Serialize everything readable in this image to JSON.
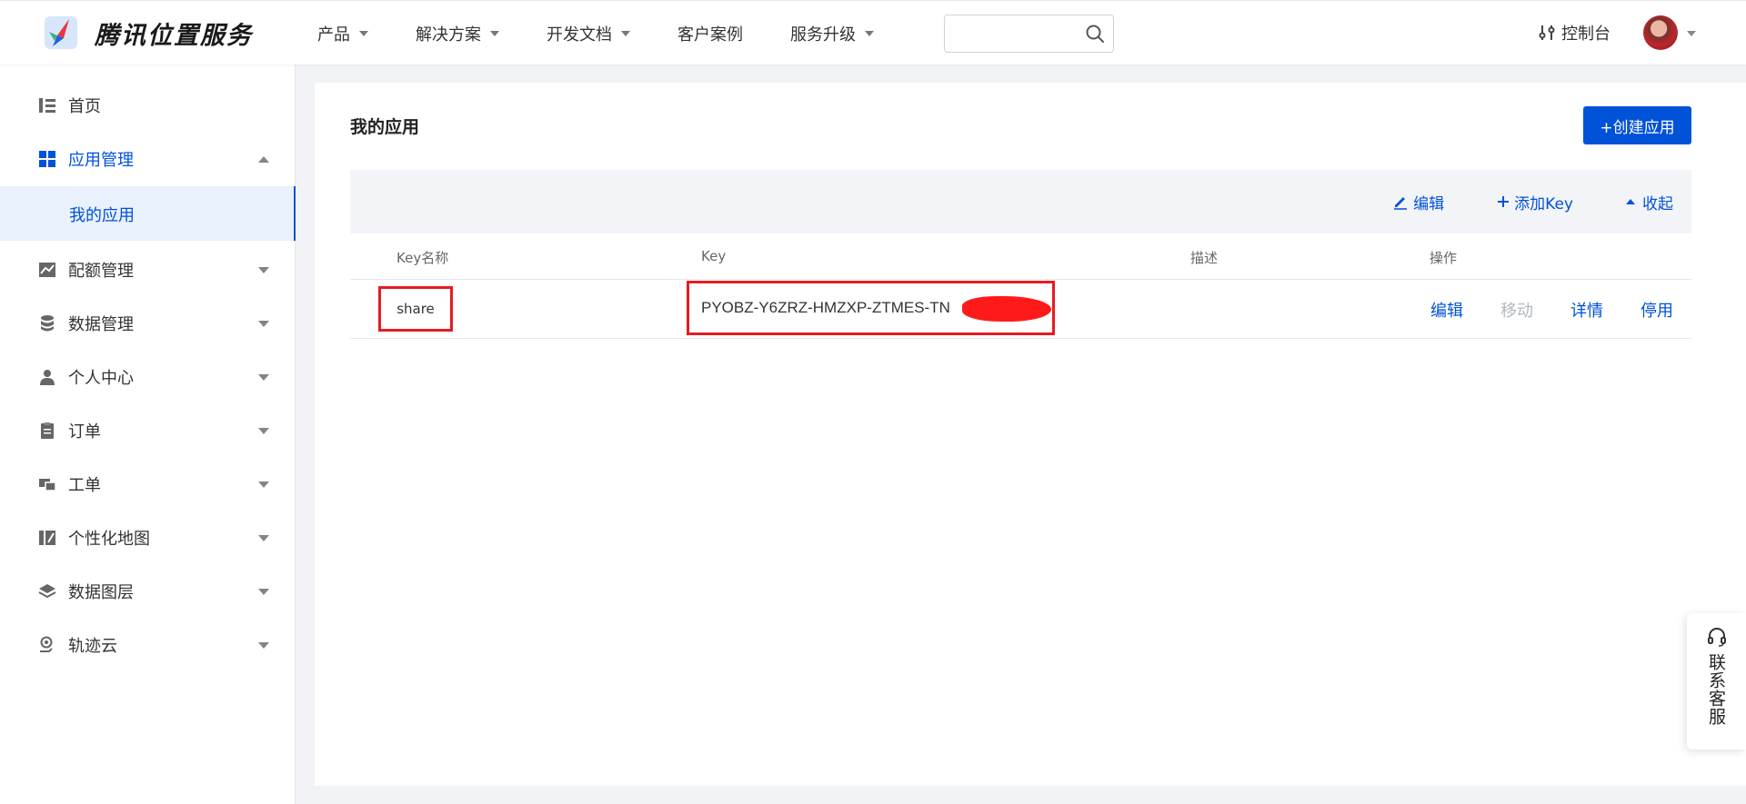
{
  "header": {
    "brand": "腾讯位置服务",
    "nav": [
      {
        "label": "产品",
        "has_menu": true
      },
      {
        "label": "解决方案",
        "has_menu": true
      },
      {
        "label": "开发文档",
        "has_menu": true
      },
      {
        "label": "客户案例",
        "has_menu": false
      },
      {
        "label": "服务升级",
        "has_menu": true
      }
    ],
    "search": {
      "value": "",
      "placeholder": ""
    },
    "console_label": "控制台"
  },
  "sidebar": {
    "items": [
      {
        "label": "首页",
        "icon": "home-list-icon"
      },
      {
        "label": "应用管理",
        "icon": "grid-apps-icon",
        "expanded": true
      },
      {
        "label": "配额管理",
        "icon": "chart-icon"
      },
      {
        "label": "数据管理",
        "icon": "database-icon"
      },
      {
        "label": "个人中心",
        "icon": "user-icon"
      },
      {
        "label": "订单",
        "icon": "clipboard-icon"
      },
      {
        "label": "工单",
        "icon": "ticket-icon"
      },
      {
        "label": "个性化地图",
        "icon": "custom-map-icon"
      },
      {
        "label": "数据图层",
        "icon": "layers-icon"
      },
      {
        "label": "轨迹云",
        "icon": "track-pin-icon"
      }
    ],
    "sub_active": "我的应用"
  },
  "main": {
    "title": "我的应用",
    "create_button": "+创建应用",
    "app_bar": {
      "edit": "编辑",
      "add_key": "添加Key",
      "collapse": "收起"
    },
    "table": {
      "columns": [
        "Key名称",
        "Key",
        "描述",
        "操作"
      ],
      "rows": [
        {
          "name": "share",
          "key": "PYOBZ-Y6ZRZ-HMZXP-ZTMES-TN",
          "description": "",
          "actions": {
            "edit": "编辑",
            "move": "移动",
            "detail": "详情",
            "disable": "停用"
          }
        }
      ]
    }
  },
  "contact": {
    "label": "联系客服"
  },
  "colors": {
    "accent": "#0052d9",
    "highlight_box": "#e51c23",
    "redaction": "#ff1a1a"
  }
}
